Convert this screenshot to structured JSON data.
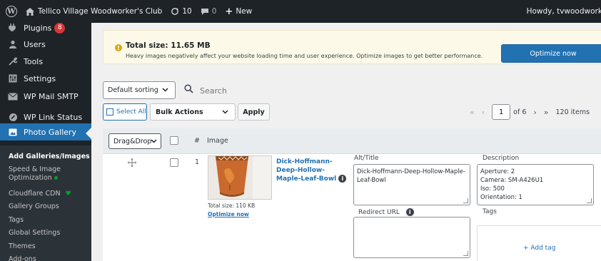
{
  "adminbar": {
    "site_name": "Tellico Village Woodworker's Club",
    "updates_count": "10",
    "comments_count": "0",
    "new_label": "New",
    "howdy": "Howdy, tvwoodworke"
  },
  "sidebar": {
    "items": [
      {
        "label": "Plugins",
        "icon": "plugins-icon",
        "badge": "8"
      },
      {
        "label": "Users",
        "icon": "users-icon"
      },
      {
        "label": "Tools",
        "icon": "tools-icon"
      },
      {
        "label": "Settings",
        "icon": "settings-icon"
      },
      {
        "label": "WP Mail SMTP",
        "icon": "mail-icon"
      },
      {
        "label": "WP Link Status",
        "icon": "link-status-icon"
      },
      {
        "label": "Photo Gallery",
        "icon": "photo-gallery-icon",
        "active": true
      }
    ],
    "submenu": [
      {
        "label": "Add Galleries/Images",
        "current": true
      },
      {
        "label": "Speed & Image Optimization",
        "dot": "green"
      },
      {
        "label": "Cloudflare CDN",
        "icon": "heart"
      },
      {
        "label": "Gallery Groups"
      },
      {
        "label": "Tags"
      },
      {
        "label": "Global Settings"
      },
      {
        "label": "Themes"
      },
      {
        "label": "Add-ons"
      }
    ]
  },
  "notice": {
    "title": "Total size: 11.65 MB",
    "text": "Heavy images negatively affect your website loading time and user experience. Optimize images to get better performance.",
    "button": "Optimize now"
  },
  "toolbar": {
    "sorting": "Default sorting",
    "search_placeholder": "Search",
    "select_all": "Select All",
    "bulk_actions": "Bulk Actions",
    "apply": "Apply",
    "first": "«",
    "prev": "‹",
    "page": "1",
    "of_pages": "of 6",
    "next": "›",
    "last": "»",
    "items": "120 items"
  },
  "table": {
    "drag_drop": "Drag&Drop",
    "col_num": "#",
    "col_image": "Image",
    "rows": [
      {
        "num": "1",
        "title": "Dick-Hoffmann-Deep-Hollow-Maple-Leaf-Bowl",
        "total_size": "Total size: 110 KB",
        "optimize": "Optimize now",
        "alt_label": "Alt/Title",
        "alt_value": "Dick-Hoffmann-Deep-Hollow-Maple-Leaf-Bowl",
        "desc_label": "Description",
        "description": [
          "Aperture: 2",
          "Camera: SM-A426U1",
          "Iso: 500",
          "Orientation: 1"
        ],
        "redirect_label": "Redirect URL",
        "tags_label": "Tags",
        "add_tag": "+ Add tag"
      }
    ]
  },
  "colors": {
    "admin_bg": "#1d2327",
    "accent": "#2271b1",
    "notice_bg": "#fcf9e8",
    "warning": "#dba617"
  }
}
